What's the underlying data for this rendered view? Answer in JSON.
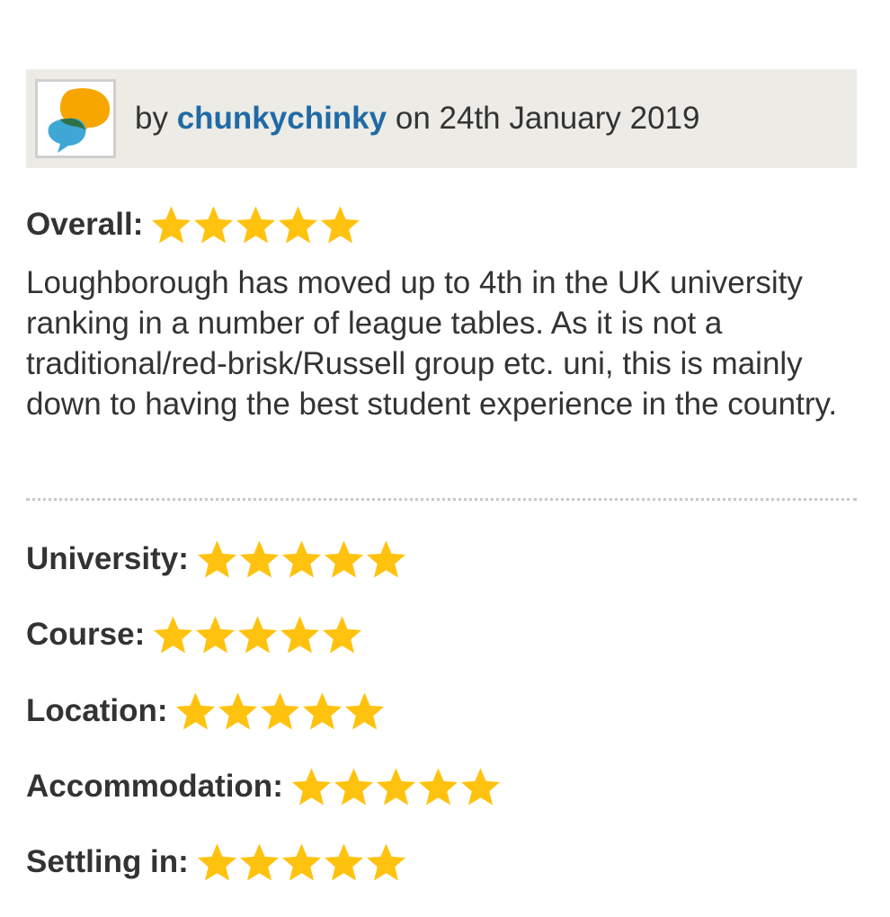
{
  "review": {
    "by_prefix": "by",
    "author": "chunkychinky",
    "date_text": "on 24th January 2019",
    "overall": {
      "label": "Overall:",
      "rating": 5,
      "max": 5
    },
    "body": "Loughborough has moved up to 4th in the UK university ranking in a number of league tables. As it is not a traditional/red-brisk/Russell group etc. uni, this is mainly down to having the best student experience in the country.",
    "categories": [
      {
        "label": "University:",
        "rating": 5,
        "max": 5
      },
      {
        "label": "Course:",
        "rating": 5,
        "max": 5
      },
      {
        "label": "Location:",
        "rating": 5,
        "max": 5
      },
      {
        "label": "Accommodation:",
        "rating": 5,
        "max": 5
      },
      {
        "label": "Settling in:",
        "rating": 5,
        "max": 5
      }
    ]
  },
  "icons": {
    "avatar": "speech-bubbles-icon",
    "rating_star": "star-icon"
  },
  "colors": {
    "header_background": "#ecebe6",
    "author_link": "#1f6aa5",
    "star_fill": "#ffc20e",
    "text": "#333333",
    "avatar_bubble_orange": "#f7a600",
    "avatar_bubble_blue": "#3fa7d6"
  }
}
